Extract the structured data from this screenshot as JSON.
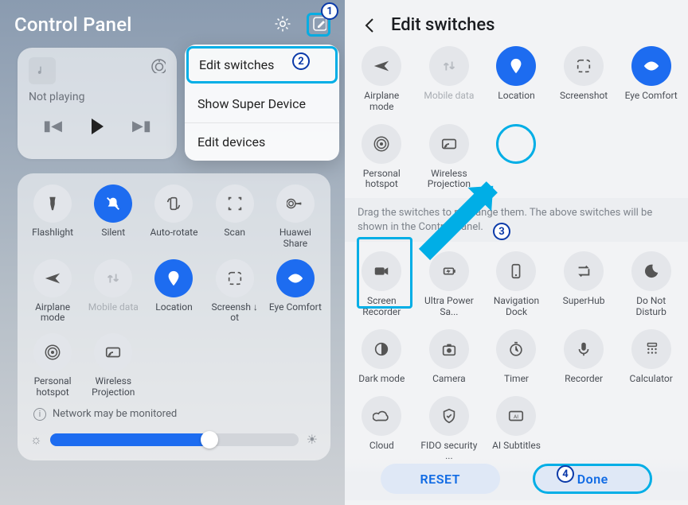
{
  "left": {
    "title": "Control Panel",
    "menu": {
      "edit": "Edit switches",
      "super": "Show Super Device",
      "devices": "Edit devices"
    },
    "media": {
      "not_playing": "Not playing"
    },
    "tiles": [
      {
        "id": "flashlight",
        "label": "Flashlight"
      },
      {
        "id": "silent",
        "label": "Silent",
        "active": true
      },
      {
        "id": "autorotate",
        "label": "Auto-rotate"
      },
      {
        "id": "scan",
        "label": "Scan"
      },
      {
        "id": "hwshare",
        "label": "Huawei Share"
      },
      {
        "id": "airplane",
        "label": "Airplane mode"
      },
      {
        "id": "mobiledata",
        "label": "Mobile data",
        "dim": true
      },
      {
        "id": "location",
        "label": "Location",
        "active": true
      },
      {
        "id": "screenshot",
        "label": "Screensh ↓ ot"
      },
      {
        "id": "eyecomfort",
        "label": "Eye Comfort",
        "active": true
      },
      {
        "id": "hotspot",
        "label": "Personal hotspot"
      },
      {
        "id": "wproj",
        "label": "Wireless Projection"
      }
    ],
    "info": "Network may be monitored"
  },
  "right": {
    "title": "Edit switches",
    "top": [
      {
        "id": "airplane",
        "label": "Airplane mode"
      },
      {
        "id": "mobiledata",
        "label": "Mobile data",
        "dim": true
      },
      {
        "id": "location",
        "label": "Location",
        "active": true
      },
      {
        "id": "screenshot",
        "label": "Screenshot"
      },
      {
        "id": "eyecomfort",
        "label": "Eye Comfort",
        "active": true
      },
      {
        "id": "hotspot",
        "label": "Personal hotspot"
      },
      {
        "id": "wproj",
        "label": "Wireless Projection"
      }
    ],
    "drag_text": "Drag the switches to rearrange them. The above switches will be shown in the Control Panel.",
    "bottom": [
      {
        "id": "screenrec",
        "label": "Screen Recorder"
      },
      {
        "id": "ultrapower",
        "label": "Ultra Power Sa..."
      },
      {
        "id": "navdock",
        "label": "Navigation Dock"
      },
      {
        "id": "superhub",
        "label": "SuperHub"
      },
      {
        "id": "dnd",
        "label": "Do Not Disturb"
      },
      {
        "id": "darkmode",
        "label": "Dark mode"
      },
      {
        "id": "camera",
        "label": "Camera"
      },
      {
        "id": "timer",
        "label": "Timer"
      },
      {
        "id": "recorder",
        "label": "Recorder"
      },
      {
        "id": "calculator",
        "label": "Calculator"
      },
      {
        "id": "cloud",
        "label": "Cloud"
      },
      {
        "id": "fido",
        "label": "FIDO security ..."
      },
      {
        "id": "aisub",
        "label": "AI Subtitles"
      }
    ],
    "reset": "RESET",
    "done": "Done"
  },
  "steps": {
    "s1": "1",
    "s2": "2",
    "s3": "3",
    "s4": "4"
  }
}
